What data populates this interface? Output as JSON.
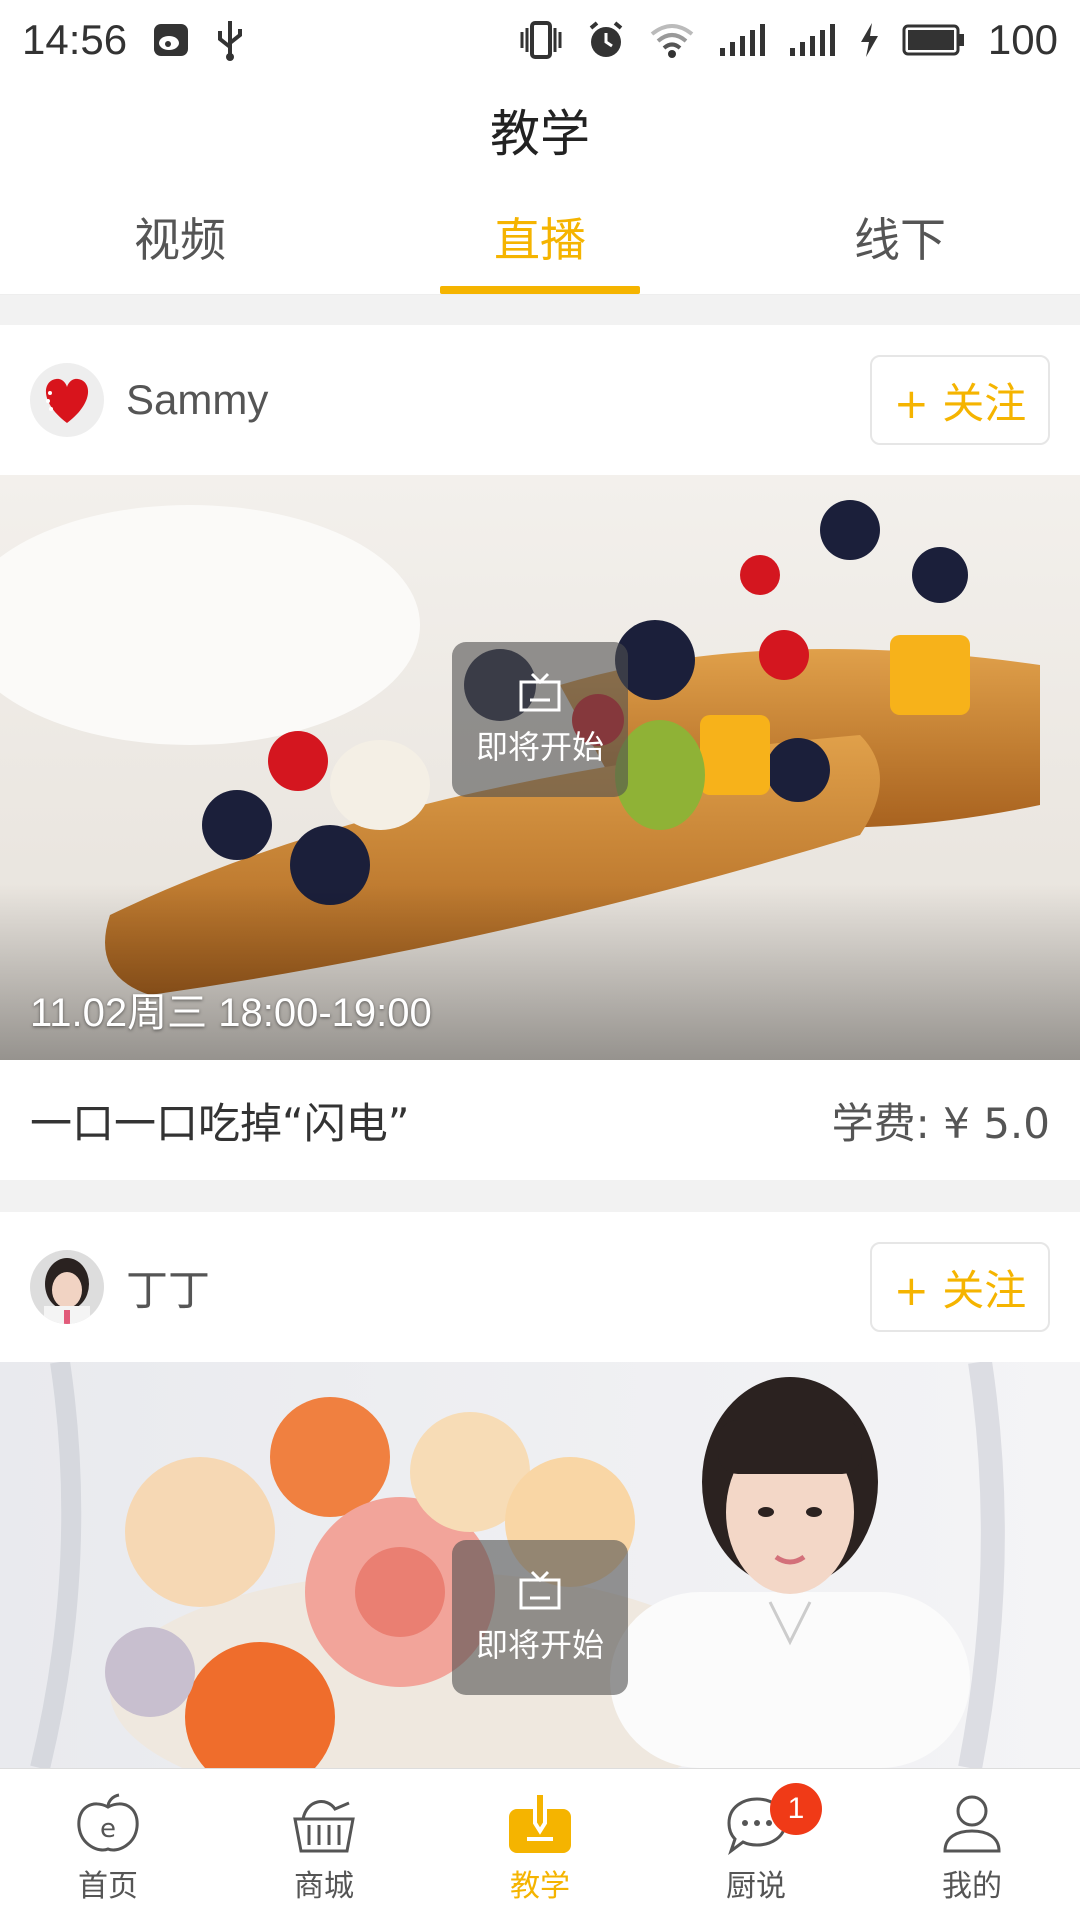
{
  "status_bar": {
    "time": "14:56",
    "battery": "100"
  },
  "title": "教学",
  "tabs": [
    {
      "label": "视频",
      "active": false
    },
    {
      "label": "直播",
      "active": true
    },
    {
      "label": "线下",
      "active": false
    }
  ],
  "cards": [
    {
      "author": "Sammy",
      "follow_label": "+ 关注",
      "badge_label": "即将开始",
      "schedule": "11.02周三 18:00-19:00",
      "title": "一口一口吃掉“闪电”",
      "fee": "学费: ¥ 5.0"
    },
    {
      "author": "丁丁",
      "follow_label": "+ 关注",
      "badge_label": "即将开始"
    }
  ],
  "bottom_nav": [
    {
      "label": "首页",
      "icon": "home-icon",
      "active": false
    },
    {
      "label": "商城",
      "icon": "basket-icon",
      "active": false
    },
    {
      "label": "教学",
      "icon": "teach-icon",
      "active": true
    },
    {
      "label": "厨说",
      "icon": "chat-icon",
      "active": false,
      "badge": "1"
    },
    {
      "label": "我的",
      "icon": "user-icon",
      "active": false
    }
  ],
  "colors": {
    "accent": "#f5b400",
    "badge": "#f03a17"
  }
}
